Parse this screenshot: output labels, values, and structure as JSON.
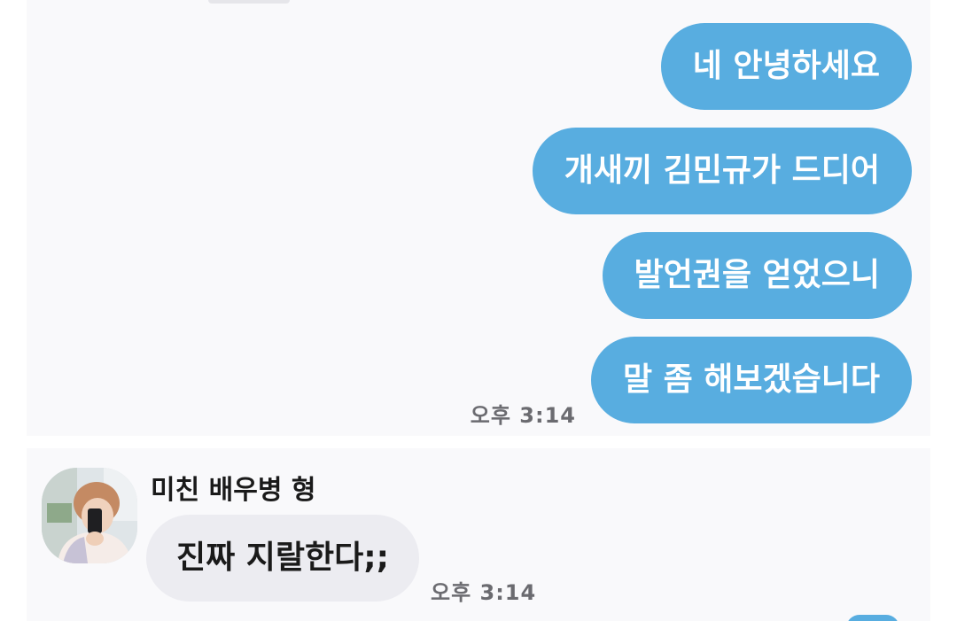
{
  "chat": {
    "outgoing_messages": [
      "네 안녕하세요",
      "개새끼 김민규가 드디어",
      "발언권을 얻었으니",
      "말 좀 해보겠습니다"
    ],
    "outgoing_time": "오후 3:14",
    "incoming": {
      "sender_name": "미친 배우병 형",
      "avatar_icon": "profile-photo",
      "message": "진짜 지랄한다;;",
      "time": "오후 3:14"
    }
  },
  "colors": {
    "outgoing_bubble": "#58ade0",
    "incoming_bubble": "#ececf1",
    "chat_background": "#f9f9fb",
    "timestamp": "#6b6b70"
  }
}
